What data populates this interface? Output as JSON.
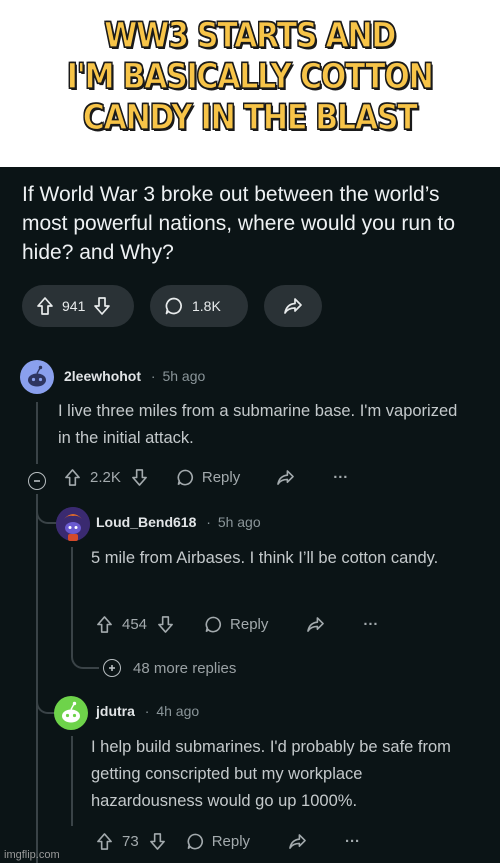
{
  "meme": {
    "caption": "WW3 STARTS AND\nI'M BASICALLY COTTON\nCANDY IN THE BLAST",
    "watermark": "imgflip.com"
  },
  "post": {
    "title": "If World War 3 broke out between the world’s most powerful nations, where would you run to hide? and Why?",
    "votes": "941",
    "comments": "1.8K"
  },
  "comments": [
    {
      "username": "2leewhohot",
      "separator": "·",
      "age": "5h ago",
      "body": "I live three miles from a submarine base. I'm vaporized in the initial attack.",
      "votes": "2.2K",
      "reply_label": "Reply",
      "more_label": "···"
    },
    {
      "username": "Loud_Bend618",
      "separator": "·",
      "age": "5h ago",
      "body": "5 mile from Airbases. I think I’ll be cotton candy.",
      "votes": "454",
      "reply_label": "Reply",
      "more_label": "···"
    },
    {
      "username": "jdutra",
      "separator": "·",
      "age": "4h ago",
      "body": "I help build submarines. I'd probably be safe from getting conscripted but my workplace hazardousness would go up 1000%.",
      "votes": "73",
      "reply_label": "Reply",
      "more_label": "···"
    }
  ],
  "more_replies": "48 more replies",
  "colors": {
    "background": "#0b1416",
    "pill": "#2a3236",
    "caption_fill": "#f7c448",
    "avatar_blue": "#8aa0ee",
    "avatar_green": "#6ed34a"
  },
  "icons": [
    "upvote-icon",
    "downvote-icon",
    "comment-icon",
    "share-icon",
    "collapse-icon",
    "expand-icon",
    "more-icon"
  ]
}
